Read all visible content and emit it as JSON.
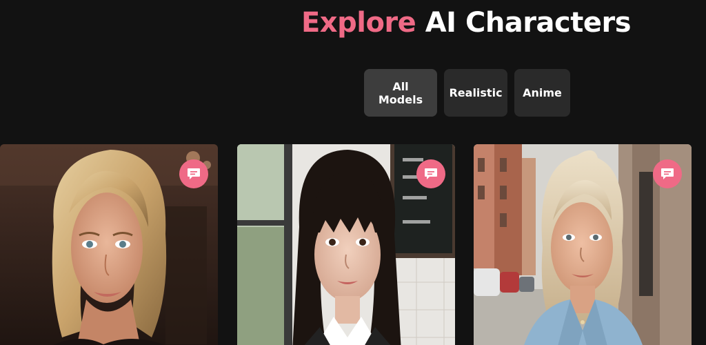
{
  "header": {
    "title_accent": "Explore",
    "title_rest": " AI Characters"
  },
  "filters": [
    {
      "label": "All Models",
      "active": true
    },
    {
      "label": "Realistic",
      "active": false
    },
    {
      "label": "Anime",
      "active": false
    }
  ],
  "cards": [
    {
      "subject": "blonde woman with bob haircut",
      "icon": "chat-icon"
    },
    {
      "subject": "woman with dark hair and bangs",
      "icon": "chat-icon"
    },
    {
      "subject": "blonde woman in denim shirt",
      "icon": "chat-icon"
    }
  ],
  "colors": {
    "background": "#121212",
    "accent": "#ef6a86",
    "button": "#2a2a2a",
    "button_active": "#3d3d3d"
  }
}
